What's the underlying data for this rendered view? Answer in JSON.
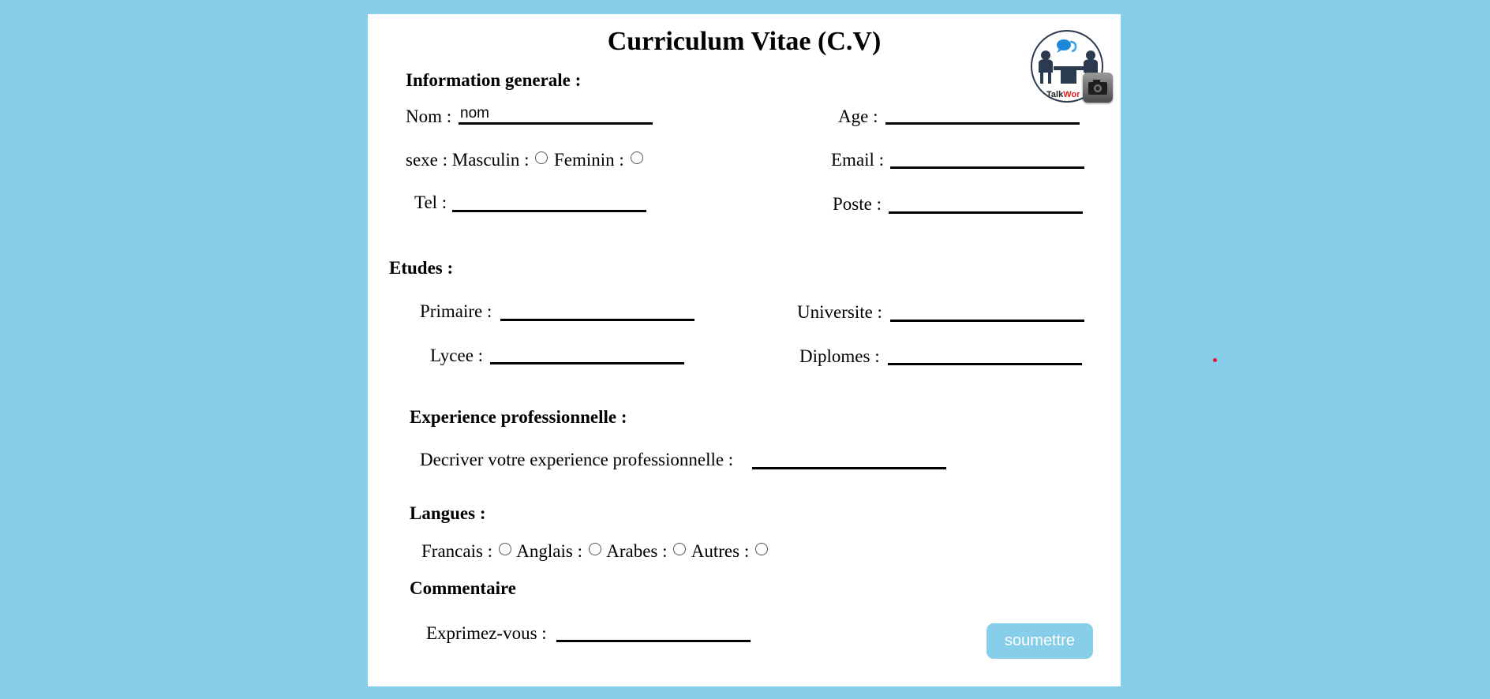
{
  "title": "Curriculum Vitae (C.V)",
  "logo": {
    "text_a": "Talk",
    "text_b": "Wor",
    "icon": "people-meeting-icon"
  },
  "camera": {
    "icon": "camera-icon"
  },
  "sections": {
    "general": "Information generale :",
    "etudes": "Etudes :",
    "experience": "Experience professionnelle :",
    "langues": "Langues :",
    "commentaire": "Commentaire"
  },
  "general": {
    "nom_label": "Nom :",
    "nom_value": "nom",
    "age_label": "Age :",
    "age_value": "",
    "sexe_label": "sexe : Masculin :",
    "feminin_label": "Feminin :",
    "email_label": "Email :",
    "email_value": "",
    "tel_label": "Tel :",
    "tel_value": "",
    "poste_label": "Poste :",
    "poste_value": ""
  },
  "etudes": {
    "primaire_label": "Primaire :",
    "primaire_value": "",
    "universite_label": "Universite :",
    "universite_value": "",
    "lycee_label": "Lycee :",
    "lycee_value": "",
    "diplomes_label": "Diplomes :",
    "diplomes_value": ""
  },
  "experience": {
    "label": "Decriver votre experience professionnelle :",
    "value": ""
  },
  "langues": {
    "francais": "Francais :",
    "anglais": "Anglais :",
    "arabes": "Arabes :",
    "autres": "Autres :"
  },
  "commentaire": {
    "label": "Exprimez-vous :",
    "value": ""
  },
  "submit_label": "soumettre",
  "colors": {
    "background": "#87ceeb",
    "button": "#87ceeb",
    "button_text": "#ffffff",
    "card": "#ffffff"
  }
}
